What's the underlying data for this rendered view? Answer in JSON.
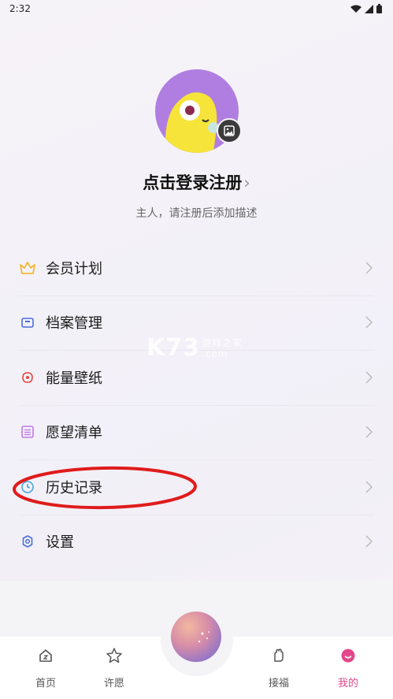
{
  "status_bar": {
    "time": "2:32"
  },
  "profile": {
    "login_title": "点击登录注册",
    "login_chevron": "›",
    "subtitle": "主人，请注册后添加描述"
  },
  "menu": {
    "items": [
      {
        "label": "会员计划",
        "icon": "crown-icon",
        "color": "#f2b935"
      },
      {
        "label": "档案管理",
        "icon": "archive-box-icon",
        "color": "#4a6fd8"
      },
      {
        "label": "能量壁纸",
        "icon": "wallpaper-icon",
        "color": "#e4473e"
      },
      {
        "label": "愿望清单",
        "icon": "list-icon",
        "color": "#c27ae6"
      },
      {
        "label": "历史记录",
        "icon": "clock-icon",
        "color": "#47a7d8"
      },
      {
        "label": "设置",
        "icon": "gear-icon",
        "color": "#4a6fd8"
      }
    ]
  },
  "watermark": {
    "text": "K73",
    "sub": "游戏之家",
    "domain": ".com"
  },
  "tab_bar": {
    "tabs": [
      {
        "label": "首页",
        "icon": "home-icon"
      },
      {
        "label": "许愿",
        "icon": "star-icon"
      },
      {
        "label": "接福",
        "icon": "hand-icon"
      },
      {
        "label": "我的",
        "icon": "profile-icon",
        "active": true
      }
    ],
    "active_color": "#e2478a"
  },
  "annotation": {
    "color": "#e01b1b"
  }
}
